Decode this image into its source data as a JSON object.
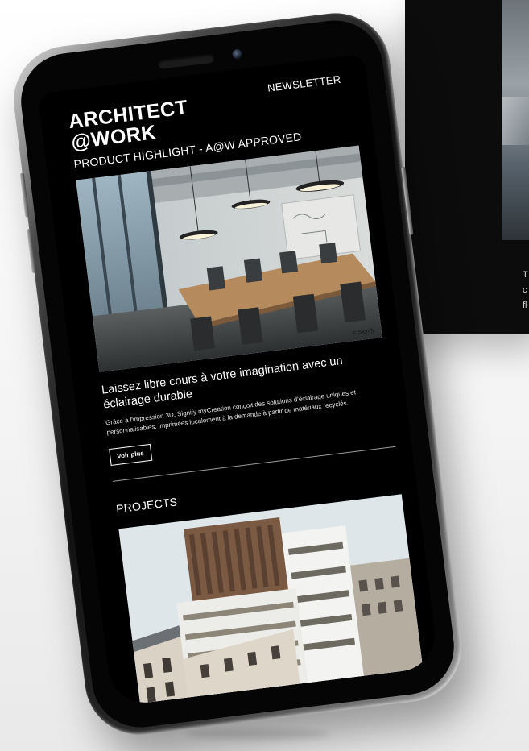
{
  "brand": {
    "line1": "ARCHITECT",
    "line2": "@WORK"
  },
  "nav": {
    "newsletter": "NEWSLETTER"
  },
  "highlight": {
    "section_title": "PRODUCT HIGHLIGHT - A@W APPROVED",
    "photo_credit": "© Signify",
    "headline": "Laissez libre cours à votre imagination avec un éclairage durable",
    "body": "Grâce à l'impression 3D, Signify myCreation conçoit des solutions d'éclairage uniques et personnalisables, imprimées localement à la demande à partir de matériaux recyclés.",
    "button_label": "Voir plus"
  },
  "projects": {
    "section_title": "PROJECTS"
  },
  "background_panel": {
    "text_fragment": "T\nc\nfl"
  },
  "colors": {
    "screen_background": "#000000",
    "text": "#ffffff",
    "divider": "#9a9a9a",
    "page_background": "#f2f2f2"
  },
  "icons": {
    "speaker": "speaker-grille-icon",
    "camera": "front-camera-icon"
  }
}
